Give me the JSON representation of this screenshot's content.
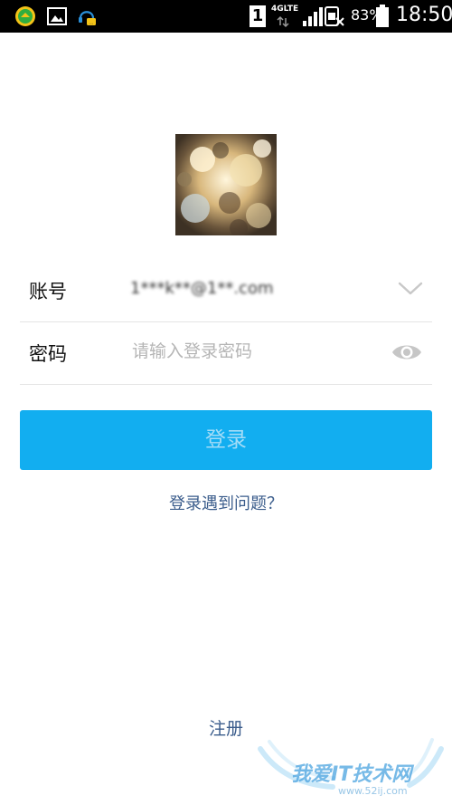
{
  "status_bar": {
    "sim_slot": "1",
    "network_type": "4GLTE",
    "battery_percent": "83%",
    "time": "18:50",
    "left_icons": [
      "app-notification-icon",
      "gallery-notification-icon",
      "qq-notification-icon"
    ]
  },
  "account": {
    "label": "账号",
    "value": "1***k**@1**.com"
  },
  "password": {
    "label": "密码",
    "placeholder": "请输入登录密码"
  },
  "login_button": {
    "label": "登录"
  },
  "problem_link": {
    "label": "登录遇到问题？"
  },
  "register_link": {
    "label": "注册"
  },
  "watermark": {
    "title": "我爱IT技术网",
    "url": "www.52ij.com"
  },
  "colors": {
    "accent": "#12aef0",
    "link": "#3b5d8c",
    "placeholder": "#b5b5b5"
  }
}
